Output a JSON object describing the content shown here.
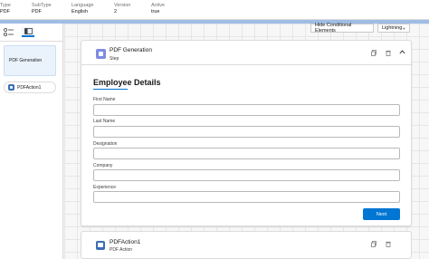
{
  "meta": {
    "type_label": "Type",
    "type_value": "PDF",
    "subtype_label": "SubType",
    "subtype_value": "PDF",
    "language_label": "Language",
    "language_value": "English",
    "version_label": "Version",
    "version_value": "2",
    "active_label": "Active",
    "active_value": "true"
  },
  "left_panel": {
    "step_card_label": "PDF Generation",
    "action_label": "PDFAction1"
  },
  "toolbar": {
    "hide_conditional_label": "Hide Conditional Elements",
    "mode_value": "Lightning"
  },
  "step": {
    "title": "PDF Generation",
    "subtitle": "Step",
    "form_title": "Employee Details",
    "fields": [
      {
        "label": "First Name",
        "value": ""
      },
      {
        "label": "Last Name",
        "value": ""
      },
      {
        "label": "Designation",
        "value": ""
      },
      {
        "label": "Company",
        "value": ""
      },
      {
        "label": "Experience",
        "value": ""
      }
    ],
    "next_label": "Next"
  },
  "action": {
    "title": "PDFAction1",
    "subtitle": "PDF Action"
  },
  "icons": {
    "step": "step-icon",
    "action": "pdf-action-icon",
    "copy": "copy-icon",
    "delete": "trash-icon",
    "collapse": "chevron-up-icon",
    "drag": "drag-handle-icon"
  },
  "colors": {
    "accent": "#0176d3",
    "step_icon": "#7e8be4",
    "action_icon": "#3c6fb5"
  }
}
